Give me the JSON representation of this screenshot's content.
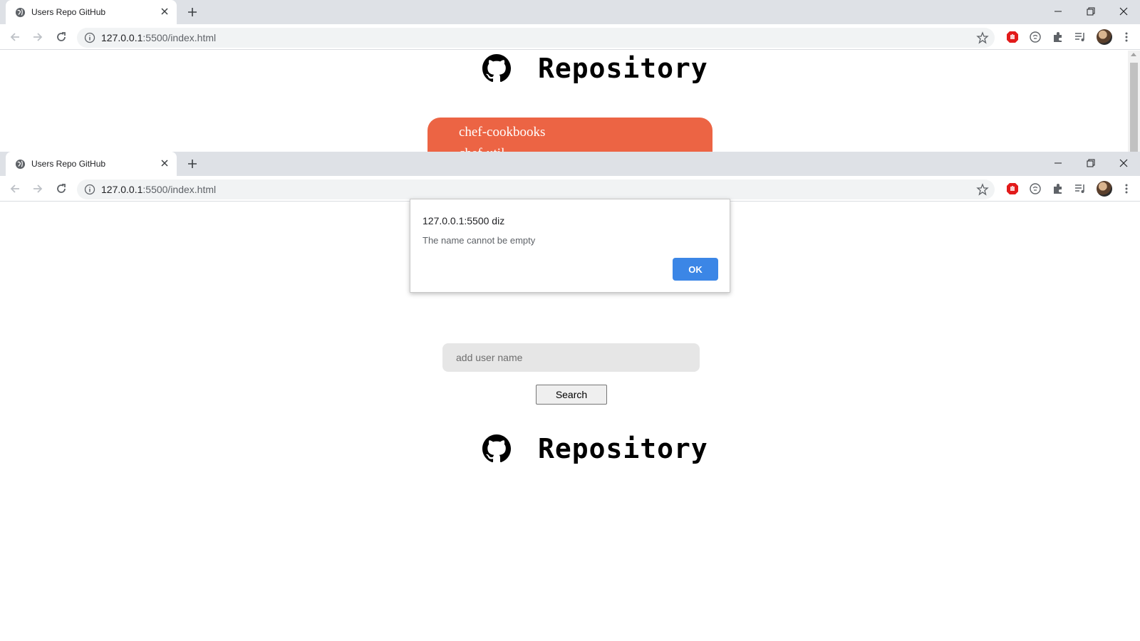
{
  "colors": {
    "repo_list_bg": "#ec6444",
    "ok_button_bg": "#3b86e6",
    "tabstrip_bg": "#dee1e6"
  },
  "top_window": {
    "tab_title": "Users Repo GitHub",
    "url_host": "127.0.0.1",
    "url_path": ":5500/index.html",
    "page": {
      "heading": "Repository",
      "repos": [
        "chef-cookbooks",
        "chef-util"
      ]
    }
  },
  "bottom_window": {
    "tab_title": "Users Repo GitHub",
    "url_host": "127.0.0.1",
    "url_path": ":5500/index.html",
    "alert": {
      "title": "127.0.0.1:5500 diz",
      "message": "The name cannot be empty",
      "ok_label": "OK"
    },
    "page": {
      "heading": "Repository",
      "input_placeholder": "add user name",
      "search_label": "Search"
    }
  }
}
